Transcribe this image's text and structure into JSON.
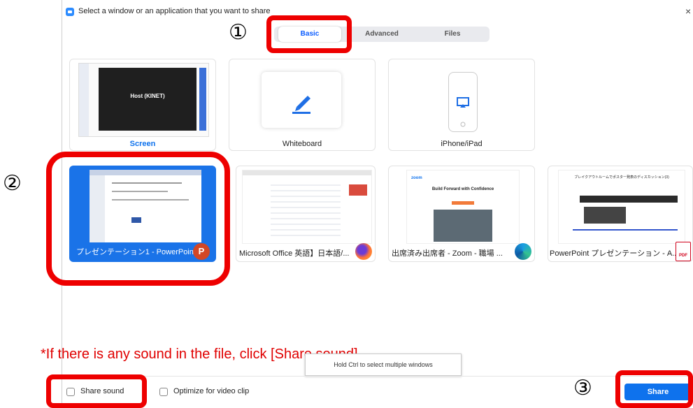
{
  "dialog": {
    "title": "Select a window or an application that you want to share",
    "close_glyph": "×"
  },
  "tabs": [
    {
      "label": "Basic",
      "active": true
    },
    {
      "label": "Advanced",
      "active": false
    },
    {
      "label": "Files",
      "active": false
    }
  ],
  "markers": {
    "one": "①",
    "two": "②",
    "three": "③"
  },
  "tiles": {
    "screen": {
      "label": "Screen",
      "host_label": "Host (KINET)"
    },
    "whiteboard": {
      "label": "Whiteboard",
      "icon": "pencil-icon"
    },
    "iphone": {
      "label": "iPhone/iPad",
      "icon": "phone-airplay-icon"
    },
    "powerpoint": {
      "label": "プレゼンテーション1 - PowerPoint",
      "app_icon": "P",
      "selected": true
    },
    "firefox": {
      "label": "Microsoft Office 英語】日本語/..."
    },
    "edge": {
      "label": "出席済み出席者 - Zoom - 職場 ...",
      "thumb_title": "Build Forward with Confidence",
      "thumb_brand": "zoom"
    },
    "pdf": {
      "label": "PowerPoint プレゼンテーション - A...",
      "app_icon": "PDF",
      "thumb_title": "ブレイクアウトルームでポスター発表のディスカッション(3)"
    }
  },
  "instruction_note": "*If there is any sound in the file, click [Share sound].",
  "tooltip": "Hold  Ctrl  to select multiple windows",
  "footer": {
    "share_sound_label": "Share sound",
    "optimize_label": "Optimize for video clip",
    "share_button": "Share"
  },
  "colors": {
    "accent": "#0e72ed",
    "highlight": "#ee0000",
    "selected_tile": "#1a73e8"
  }
}
